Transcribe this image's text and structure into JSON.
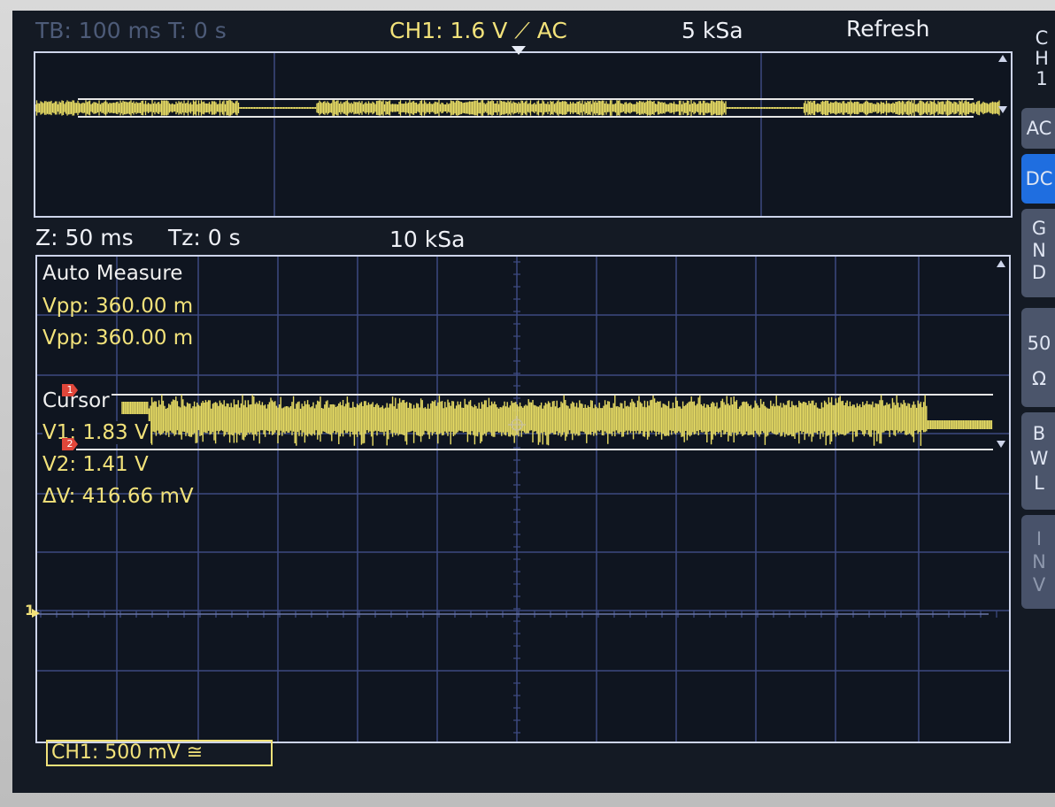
{
  "top_bar": {
    "timebase": "TB: 100 ms",
    "trigger_time": "T: 0 s",
    "channel_setting": "CH1: 1.6 V ⟋ AC",
    "sample_rate": "5 kSa",
    "mode": "Refresh"
  },
  "zoom_bar": {
    "zoom": "Z: 50 ms",
    "zoom_time": "Tz: 0 s",
    "sample_rate": "10 kSa"
  },
  "measurements": {
    "title": "Auto Measure",
    "rows": [
      "Vpp: 360.00 m",
      "Vpp: 360.00 m"
    ]
  },
  "cursor": {
    "title": "Cursor",
    "v1": "V1: 1.83 V",
    "v2": "V2: 1.41 V",
    "delta": "ΔV: 416.66 mV",
    "marker1": "1",
    "marker2": "2"
  },
  "channel_marker": "1",
  "channel_scale": "CH1: 500 mV ≅",
  "side_menu": {
    "channel": [
      "C",
      "H",
      "1"
    ],
    "buttons": [
      {
        "label": [
          "AC"
        ],
        "state": "normal"
      },
      {
        "label": [
          "DC"
        ],
        "state": "active"
      },
      {
        "label": [
          "G",
          "N",
          "D"
        ],
        "state": "normal"
      },
      {
        "label": [
          "50",
          "Ω"
        ],
        "state": "normal"
      },
      {
        "label": [
          "B",
          "W",
          "L"
        ],
        "state": "normal"
      },
      {
        "label": [
          "I",
          "N",
          "V"
        ],
        "state": "disabled"
      }
    ]
  },
  "colors": {
    "trace": "#e8dc64",
    "grid": "#3d4a80",
    "cursor_line": "#e6e6e6",
    "active_button": "#1f6ee0",
    "text_yellow": "#f2e27a"
  }
}
